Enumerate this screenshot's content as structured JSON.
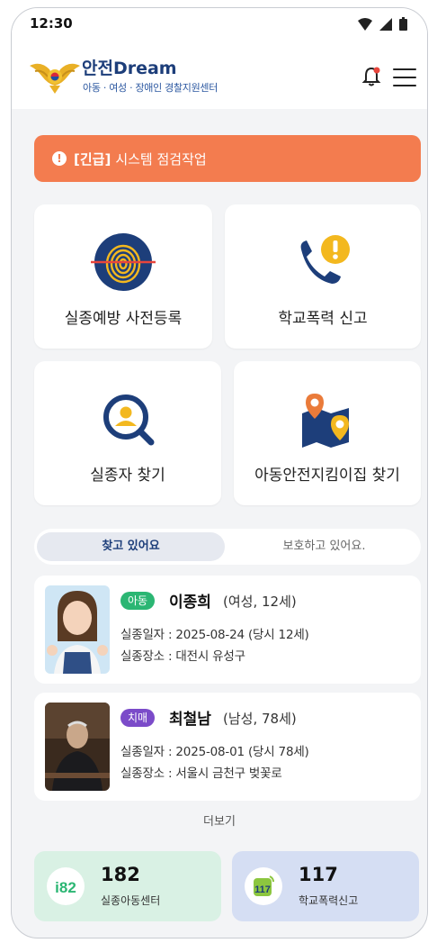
{
  "status_bar": {
    "time": "12:30"
  },
  "header": {
    "brand_title": "안전Dream",
    "brand_subtitle": "아동 · 여성 · 장애인 경찰지원센터"
  },
  "alert": {
    "tag": "[긴급]",
    "message": "시스템 점검작업",
    "color": "#f37c4f"
  },
  "menu_tiles": [
    {
      "label": "실종예방 사전등록",
      "icon": "fingerprint-icon"
    },
    {
      "label": "학교폭력 신고",
      "icon": "phone-alert-icon"
    },
    {
      "label": "실종자 찾기",
      "icon": "search-person-icon"
    },
    {
      "label": "아동안전지킴이집 찾기",
      "icon": "map-pin-icon"
    }
  ],
  "tabs": [
    {
      "label": "찾고 있어요",
      "active": true
    },
    {
      "label": "보호하고 있어요.",
      "active": false
    }
  ],
  "persons": [
    {
      "badge": "아동",
      "badge_color": "#2bb673",
      "name": "이종희",
      "meta": "(여성, 12세)",
      "missing_date": "실종일자 : 2025-08-24 (당시 12세)",
      "missing_place": "실종장소 : 대전시 유성구"
    },
    {
      "badge": "치매",
      "badge_color": "#7b4bc9",
      "name": "최철남",
      "meta": "(남성, 78세)",
      "missing_date": "실종일자 : 2025-08-01 (당시 78세)",
      "missing_place": "실종장소 : 서울시 금천구 벚꽃로"
    }
  ],
  "more_label": "더보기",
  "hotlines": [
    {
      "number": "182",
      "label": "실종아동센터",
      "bg": "#d9f1e4",
      "icon": "182-logo-icon"
    },
    {
      "number": "117",
      "label": "학교폭력신고",
      "bg": "#d5def3",
      "icon": "117-logo-icon"
    }
  ]
}
